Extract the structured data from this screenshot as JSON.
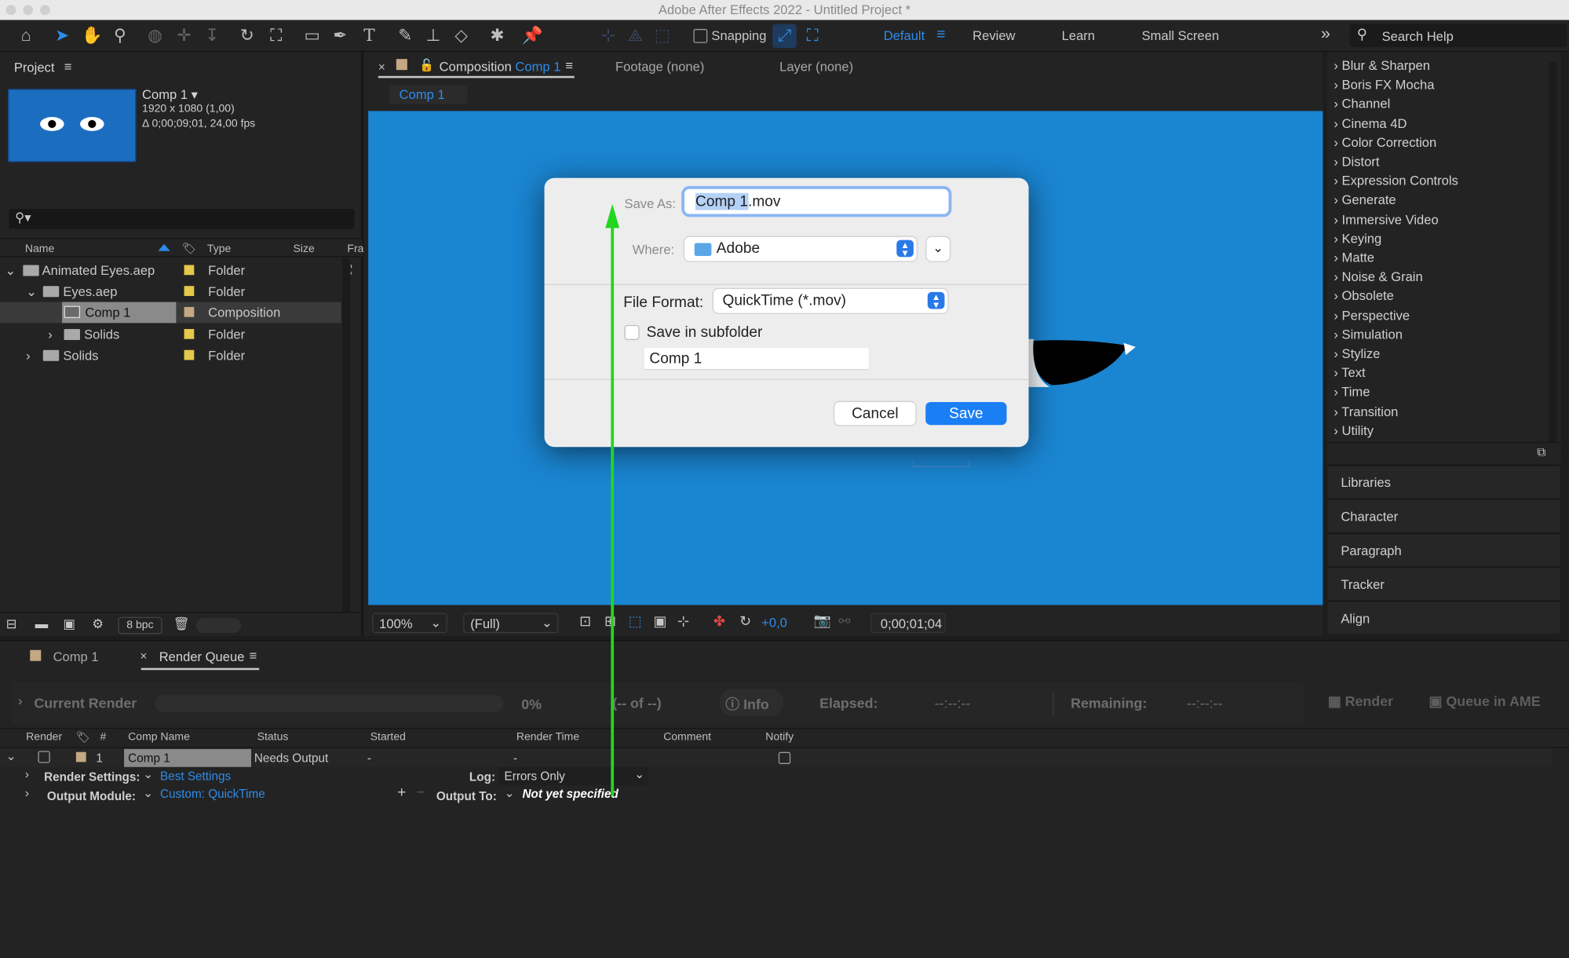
{
  "window": {
    "title": "Adobe After Effects 2022 - Untitled Project *"
  },
  "toolbar": {
    "snapping_label": "Snapping",
    "workspaces": [
      "Default",
      "Review",
      "Learn",
      "Small Screen"
    ],
    "search_placeholder": "Search Help"
  },
  "project": {
    "title": "Project",
    "comp_name": "Comp 1 ▾",
    "comp_res": "1920 x 1080 (1,00)",
    "comp_duration": "Δ 0;00;09;01, 24,00 fps",
    "columns": {
      "name": "Name",
      "type": "Type",
      "size": "Size",
      "frame": "Fra"
    },
    "rows": [
      {
        "name": "Animated Eyes.aep",
        "type": "Folder"
      },
      {
        "name": "Eyes.aep",
        "type": "Folder"
      },
      {
        "name": "Comp 1",
        "type": "Composition"
      },
      {
        "name": "Solids",
        "type": "Folder"
      },
      {
        "name": "Solids",
        "type": "Folder"
      }
    ],
    "bpc": "8 bpc"
  },
  "viewer": {
    "tabs": {
      "composition_prefix": "Composition",
      "composition_name": "Comp 1",
      "footage": "Footage (none)",
      "layer": "Layer (none)"
    },
    "breadcrumb": "Comp 1",
    "zoom": "100%",
    "resolution": "(Full)",
    "exposure": "+0,0",
    "timecode": "0;00;01;04",
    "bg_color": "#1a85d1"
  },
  "effects": {
    "items": [
      "Blur & Sharpen",
      "Boris FX Mocha",
      "Channel",
      "Cinema 4D",
      "Color Correction",
      "Distort",
      "Expression Controls",
      "Generate",
      "Immersive Video",
      "Keying",
      "Matte",
      "Noise & Grain",
      "Obsolete",
      "Perspective",
      "Simulation",
      "Stylize",
      "Text",
      "Time",
      "Transition",
      "Utility"
    ],
    "panels": [
      "Libraries",
      "Character",
      "Paragraph",
      "Tracker",
      "Align"
    ]
  },
  "render_queue": {
    "tabs": [
      "Comp 1",
      "Render Queue"
    ],
    "current_render": "Current Render",
    "progress_pct": "0%",
    "of_label": "(-- of --)",
    "info_label": "Info",
    "elapsed_label": "Elapsed:",
    "elapsed_value": "--:--:--",
    "remaining_label": "Remaining:",
    "remaining_value": "--:--:--",
    "render_button": "Render",
    "queue_ame_button": "Queue in AME",
    "columns": [
      "Render",
      "#",
      "Comp Name",
      "Status",
      "Started",
      "Render Time",
      "Comment",
      "Notify"
    ],
    "item": {
      "num": "1",
      "comp_name": "Comp 1",
      "status": "Needs Output",
      "started": "-",
      "render_time": "-"
    },
    "render_settings_label": "Render Settings:",
    "render_settings_value": "Best Settings",
    "log_label": "Log:",
    "log_value": "Errors Only",
    "output_module_label": "Output Module:",
    "output_module_value": "Custom: QuickTime",
    "output_to_label": "Output To:",
    "output_to_value": "Not yet specified"
  },
  "dialog": {
    "save_as_label": "Save As:",
    "save_as_selected": "Comp 1",
    "save_as_rest": ".mov",
    "where_label": "Where:",
    "where_value": "Adobe",
    "file_format_label": "File Format:",
    "file_format_value": "QuickTime (*.mov)",
    "subfolder_label": "Save in subfolder",
    "subfolder_value": "Comp 1",
    "cancel_label": "Cancel",
    "save_label": "Save"
  },
  "colors": {
    "accent": "#2d8ceb",
    "annotation_arrow": "#22d622",
    "label_yellow": "#e4c94a"
  }
}
